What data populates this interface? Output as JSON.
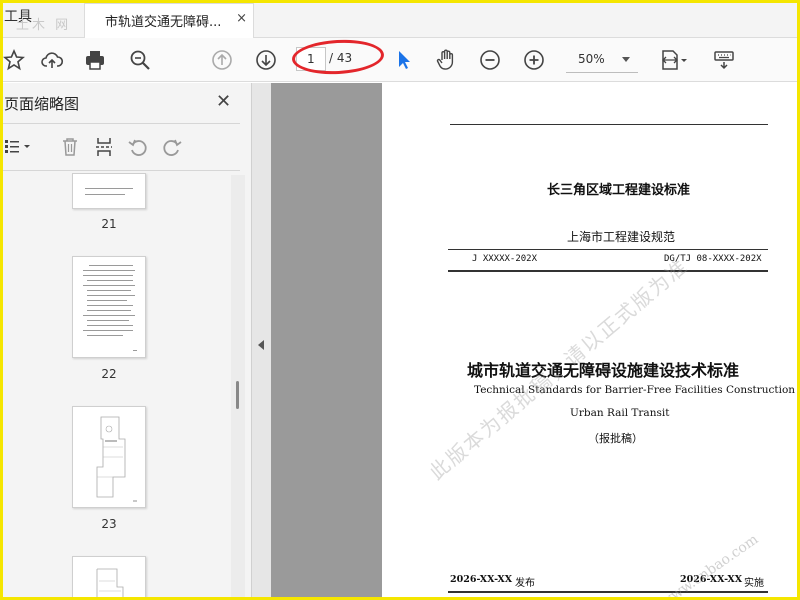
{
  "tab_bar": {
    "tools_label": "工具",
    "watermark": "土木 网",
    "document_tab_label": "市轨道交通无障碍...",
    "close_symbol": "×"
  },
  "toolbar": {
    "current_page": "1",
    "total_pages": "/ 43",
    "zoom_level": "50%",
    "icons": [
      "bookmark-star-icon",
      "cloud-upload-icon",
      "print-icon",
      "search-zoom-icon",
      "page-up-icon",
      "page-down-icon",
      "select-cursor-icon",
      "hand-tool-icon",
      "zoom-out-icon",
      "zoom-in-icon",
      "page-fit-icon",
      "keyboard-icon"
    ],
    "highlight_color": "#e3262b",
    "cursor_color": "#1a73e8"
  },
  "sidebar": {
    "title": "页面缩略图",
    "close_symbol": "✕",
    "tools": [
      "thumbnail-options-icon",
      "delete-page-icon",
      "insert-page-icon",
      "rotate-ccw-icon",
      "rotate-cw-icon"
    ],
    "thumbnails": [
      {
        "number": "21"
      },
      {
        "number": "22"
      },
      {
        "number": "23"
      },
      {
        "number": ""
      }
    ]
  },
  "document": {
    "standard_category": "长三角区域工程建设标准",
    "regulation": "上海市工程建设规范",
    "code_left": "J XXXXX-202X",
    "code_right": "DG/TJ 08-XXXX-202X",
    "title_cn": "城市轨道交通无障碍设施建设技术标准",
    "title_en_line1": "Technical Standards for Barrier-Free Facilities Construction in",
    "title_en_line2": "Urban Rail Transit",
    "draft_label": "（报批稿）",
    "publish_date": "2026-XX-XX",
    "publish_label": "发布",
    "implement_date": "2026-XX-XX",
    "implement_label": "实施",
    "watermark_text": "此版本为报批稿，请以正式版为准",
    "watermark_site": "www.cnbao.com"
  },
  "colors": {
    "frame": "#f5e600",
    "sidebar_bg": "#f4f4f4",
    "gray_strip": "#9a9a9a"
  }
}
